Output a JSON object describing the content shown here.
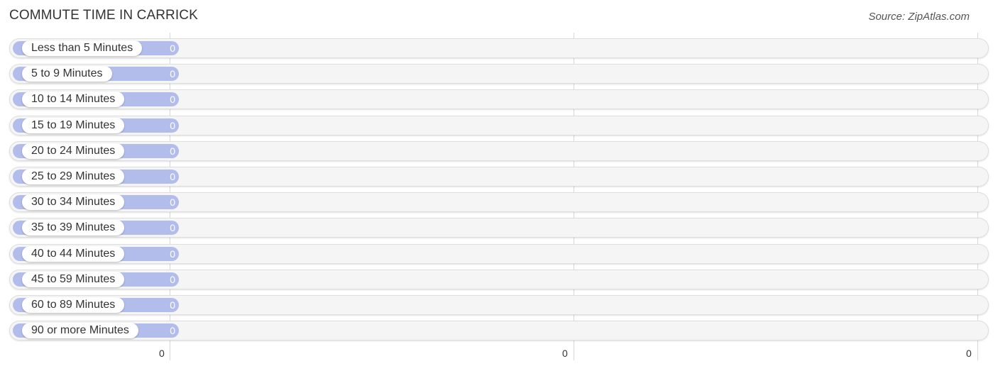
{
  "title": "COMMUTE TIME IN CARRICK",
  "source": "Source: ZipAtlas.com",
  "colors": {
    "bar": "#b3bdeb",
    "track": "#f5f5f5",
    "text": "#333333"
  },
  "chart_data": {
    "type": "bar",
    "orientation": "horizontal",
    "title": "COMMUTE TIME IN CARRICK",
    "categories": [
      "Less than 5 Minutes",
      "5 to 9 Minutes",
      "10 to 14 Minutes",
      "15 to 19 Minutes",
      "20 to 24 Minutes",
      "25 to 29 Minutes",
      "30 to 34 Minutes",
      "35 to 39 Minutes",
      "40 to 44 Minutes",
      "45 to 59 Minutes",
      "60 to 89 Minutes",
      "90 or more Minutes"
    ],
    "values": [
      0,
      0,
      0,
      0,
      0,
      0,
      0,
      0,
      0,
      0,
      0,
      0
    ],
    "value_labels": [
      "0",
      "0",
      "0",
      "0",
      "0",
      "0",
      "0",
      "0",
      "0",
      "0",
      "0",
      "0"
    ],
    "x_tick_labels": [
      "0",
      "0",
      "0"
    ],
    "xlabel": "",
    "ylabel": "",
    "xlim": [
      0,
      0
    ],
    "grid": true,
    "legend": "none"
  }
}
